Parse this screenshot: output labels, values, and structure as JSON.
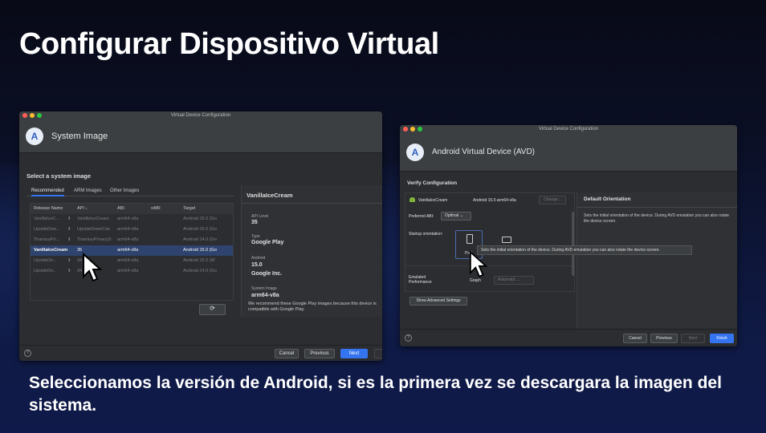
{
  "slide": {
    "title": "Configurar Dispositivo Virtual",
    "caption": "Seleccionamos la versión de Android, si es la primera vez se descargara la imagen del sistema."
  },
  "left_window": {
    "window_title": "Virtual Device Configuration",
    "header_title": "System Image",
    "section_label": "Select a system image",
    "tabs": [
      "Recommended",
      "ARM Images",
      "Other Images"
    ],
    "columns": [
      "Release Name",
      "API ↓",
      "ABI",
      "xABI",
      "Target"
    ],
    "rows": [
      {
        "name": "VanillaIceC...",
        "api": "VanillaIceCream",
        "abi": "arm64-v8a",
        "target": "Android 15.0 (Go"
      },
      {
        "name": "UpsideDow...",
        "api": "UpsideDownCak",
        "abi": "arm64-v8a",
        "target": "Android 15.0 (Go"
      },
      {
        "name": "TiramisuPri...",
        "api": "TiramisuPrivacyS",
        "abi": "arm64-v8a",
        "target": "Android 14.0 (Go"
      },
      {
        "name": "VanillaIceCream",
        "api": "35",
        "abi": "arm64-v8a",
        "target": "Android 15.0 (Go",
        "selected": true
      },
      {
        "name": "UpsideDo...",
        "api": "34",
        "abi": "arm64-v8a",
        "target": "Android 15.0 (W"
      },
      {
        "name": "UpsideDo...",
        "api": "34",
        "abi": "arm64-v8a",
        "target": "Android 14.0 (Go"
      }
    ],
    "detail": {
      "name": "VanillaIceCream",
      "api_level_label": "API Level",
      "api_level": "35",
      "type_label": "Type",
      "type": "Google Play",
      "android_label": "Android",
      "android_version": "15.0",
      "vendor": "Google Inc.",
      "system_image_label": "System Image",
      "system_image": "arm64-v8a",
      "recommendation": "We recommend these Google Play images because this device is compatible with Google Play."
    },
    "buttons": {
      "cancel": "Cancel",
      "previous": "Previous",
      "next": "Next"
    },
    "help": "?"
  },
  "right_window": {
    "window_title": "Virtual Device Configuration",
    "header_title": "Android Virtual Device (AVD)",
    "section_label": "Verify Configuration",
    "device_name": "VanillaIceCream",
    "device_target": "Android 15.0 arm64-v8a",
    "change_button": "Change...",
    "preferred_abi_label": "Preferred ABI:",
    "preferred_abi_value": "Optimal",
    "startup_orientation_label": "Startup orientation:",
    "portrait_label": "Port",
    "tooltip": "Sets the initial orientation of the device. During AVD emulation you can also rotate the device screen.",
    "emulated_performance_label": "Emulated Performance",
    "graphics_label": "Graph",
    "graphics_value": "Automatic",
    "show_advanced": "Show Advanced Settings",
    "side_title": "Default Orientation",
    "side_text": "Sets the initial orientation of the device. During AVD emulation you can also rotate the device screen.",
    "buttons": {
      "cancel": "Cancel",
      "previous": "Previous",
      "next": "Next",
      "finish": "Finish"
    },
    "help": "?"
  },
  "colors": {
    "accent": "#3574f0",
    "selection": "#2e436e",
    "window_bg": "#2b2d30"
  }
}
